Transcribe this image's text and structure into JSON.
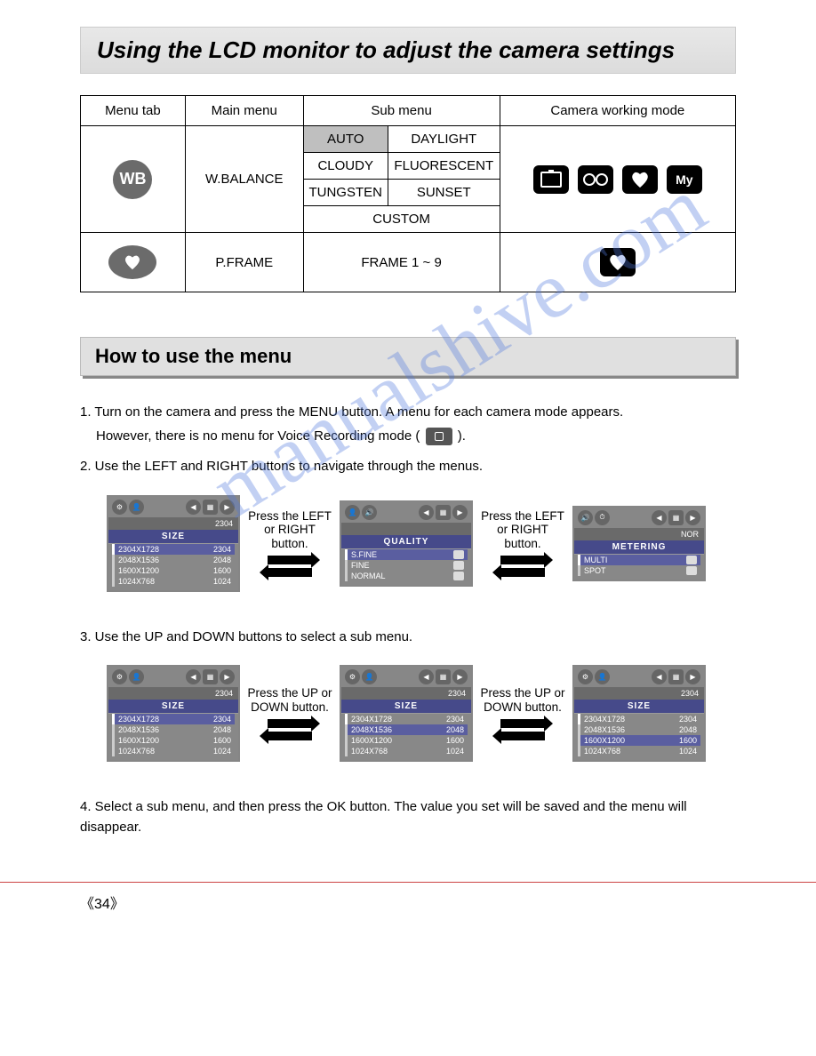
{
  "title": "Using the LCD monitor to adjust the camera settings",
  "table": {
    "headers": [
      "Menu tab",
      "Main menu",
      "Sub menu",
      "Camera working mode"
    ],
    "row1": {
      "icon_label": "WB",
      "main": "W.BALANCE",
      "sub": [
        "AUTO",
        "DAYLIGHT",
        "CLOUDY",
        "FLUORESCENT",
        "TUNGSTEN",
        "SUNSET",
        "CUSTOM"
      ],
      "mode_my": "My"
    },
    "row2": {
      "main": "P.FRAME",
      "sub": "FRAME 1 ~ 9"
    }
  },
  "section_title": "How to use the menu",
  "steps": {
    "s1a": "1. Turn on the camera and press the MENU button. A menu for each camera mode appears.",
    "s1b": "However, there is no menu for Voice Recording mode (",
    "s1c": ").",
    "s2": "2. Use the LEFT and RIGHT buttons to navigate through the menus.",
    "s3": "3. Use the UP and DOWN buttons to select a sub menu.",
    "s4": "4. Select a sub menu, and then press the OK button. The value you set will be saved and the menu will disappear."
  },
  "arrow_labels": {
    "lr": "Press the LEFT or RIGHT button.",
    "ud": "Press the UP or DOWN button."
  },
  "lcd": {
    "size_title": "SIZE",
    "quality_title": "QUALITY",
    "metering_title": "METERING",
    "sizes": [
      {
        "l": "2304X1728",
        "r": "2304"
      },
      {
        "l": "2048X1536",
        "r": "2048"
      },
      {
        "l": "1600X1200",
        "r": "1600"
      },
      {
        "l": "1024X768",
        "r": "1024"
      }
    ],
    "quality": [
      "S.FINE",
      "FINE",
      "NORMAL"
    ],
    "metering": [
      "MULTI",
      "SPOT"
    ],
    "tag_2304": "2304",
    "tag_nor": "NOR"
  },
  "watermark": "manualshive.com",
  "page_number": "34"
}
